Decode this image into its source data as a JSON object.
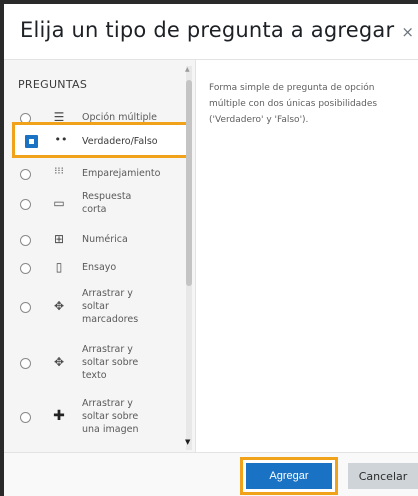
{
  "dialog": {
    "title": "Elija un tipo de pregunta a agregar",
    "close_icon": "close-icon",
    "close_glyph": "×"
  },
  "question_types": {
    "section_title": "PREGUNTAS",
    "selected_index": 1,
    "items": [
      {
        "label": "Opción múltiple",
        "icon": "multichoice-icon",
        "glyph": "☰",
        "selected": false
      },
      {
        "label": "Verdadero/Falso",
        "icon": "truefalse-icon",
        "glyph": "••",
        "selected": true
      },
      {
        "label": "Emparejamiento",
        "icon": "match-icon",
        "glyph": "⁝⁝⁝",
        "selected": false
      },
      {
        "label": "Respuesta corta",
        "lines": [
          "Respuesta",
          "corta"
        ],
        "icon": "shortanswer-icon",
        "glyph": "▭",
        "selected": false
      },
      {
        "label": "Numérica",
        "icon": "numerical-icon",
        "glyph": "⊞",
        "selected": false
      },
      {
        "label": "Ensayo",
        "icon": "essay-icon",
        "glyph": "▯",
        "selected": false
      },
      {
        "label": "Arrastrar y soltar marcadores",
        "lines": [
          "Arrastrar y",
          "soltar",
          "marcadores"
        ],
        "icon": "drag-markers-icon",
        "glyph": "✥",
        "selected": false
      },
      {
        "label": "Arrastrar y soltar sobre texto",
        "lines": [
          "Arrastrar y",
          "soltar sobre",
          "texto"
        ],
        "icon": "drag-text-icon",
        "glyph": "✥",
        "selected": false
      },
      {
        "label": "Arrastrar y soltar sobre una imagen",
        "lines": [
          "Arrastrar y",
          "soltar sobre",
          "una imagen"
        ],
        "icon": "drag-image-icon",
        "glyph": "✚",
        "selected": false
      }
    ]
  },
  "description": "Forma simple de pregunta de opción múltiple con dos únicas posibilidades ('Verdadero' y 'Falso').",
  "footer": {
    "add_label": "Agregar",
    "cancel_label": "Cancelar"
  },
  "colors": {
    "accent": "#1a72c4",
    "highlight": "#f0a21a",
    "cancel_bg": "#cfd4d8"
  }
}
